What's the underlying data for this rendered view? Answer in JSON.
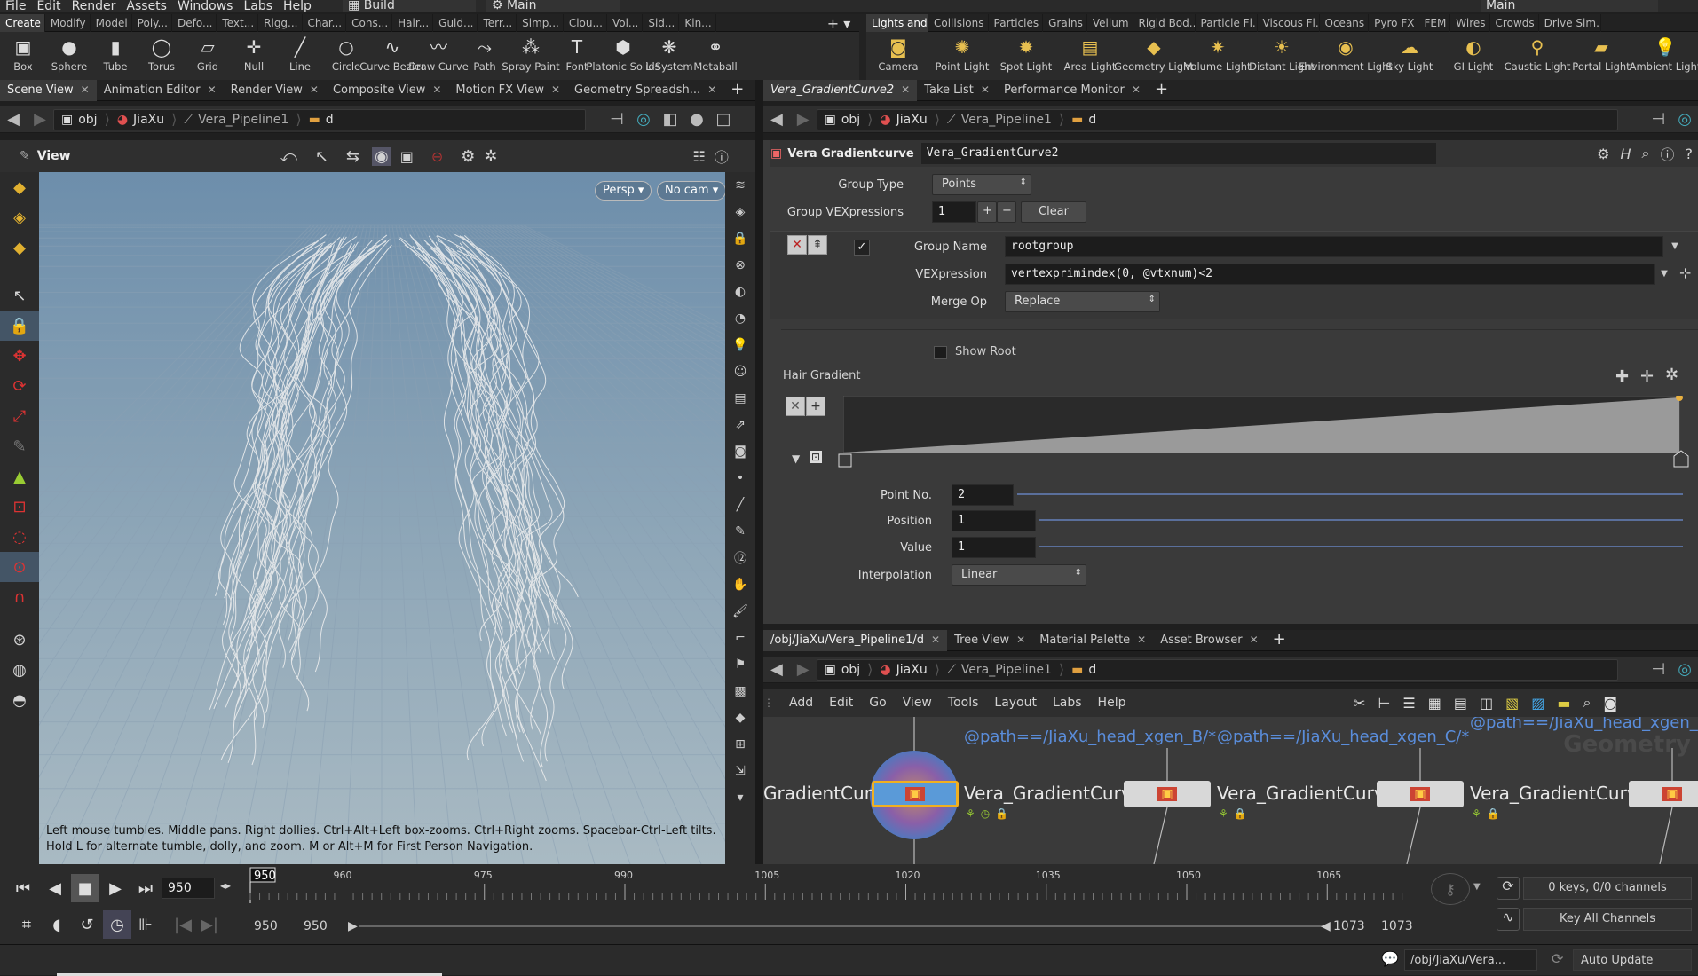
{
  "menubar": {
    "items": [
      "File",
      "Edit",
      "Render",
      "Assets",
      "Windows",
      "Labs",
      "Help"
    ],
    "desktop": "Build",
    "main": "Main",
    "right_main": "Main"
  },
  "shelf_left": {
    "tabs": [
      "Create",
      "Modify",
      "Model",
      "Poly...",
      "Defo...",
      "Text...",
      "Rigg...",
      "Char...",
      "Cons...",
      "Hair...",
      "Guid...",
      "Terr...",
      "Simp...",
      "Clou...",
      "Vol...",
      "Sid...",
      "Kin..."
    ],
    "tools": [
      {
        "label": "Box",
        "icon": "box-icon"
      },
      {
        "label": "Sphere",
        "icon": "sphere-icon"
      },
      {
        "label": "Tube",
        "icon": "tube-icon"
      },
      {
        "label": "Torus",
        "icon": "torus-icon"
      },
      {
        "label": "Grid",
        "icon": "grid-icon"
      },
      {
        "label": "Null",
        "icon": "null-icon"
      },
      {
        "label": "Line",
        "icon": "line-icon"
      },
      {
        "label": "Circle",
        "icon": "circle-icon"
      },
      {
        "label": "Curve Bezier",
        "icon": "curve-bezier-icon"
      },
      {
        "label": "Draw Curve",
        "icon": "draw-curve-icon"
      },
      {
        "label": "Path",
        "icon": "path-icon"
      },
      {
        "label": "Spray Paint",
        "icon": "spray-paint-icon"
      },
      {
        "label": "Font",
        "icon": "font-icon"
      },
      {
        "label": "Platonic Solids",
        "icon": "platonic-icon"
      },
      {
        "label": "L-System",
        "icon": "lsystem-icon"
      },
      {
        "label": "Metaball",
        "icon": "metaball-icon"
      }
    ]
  },
  "shelf_right": {
    "tabs": [
      "Lights and...",
      "Collisions",
      "Particles",
      "Grains",
      "Vellum",
      "Rigid Bod...",
      "Particle Fl...",
      "Viscous Fl...",
      "Oceans",
      "Pyro FX",
      "FEM",
      "Wires",
      "Crowds",
      "Drive Sim..."
    ],
    "tools": [
      {
        "label": "Camera",
        "icon": "camera-icon"
      },
      {
        "label": "Point Light",
        "icon": "point-light-icon"
      },
      {
        "label": "Spot Light",
        "icon": "spot-light-icon"
      },
      {
        "label": "Area Light",
        "icon": "area-light-icon"
      },
      {
        "label": "Geometry Light",
        "icon": "geometry-light-icon"
      },
      {
        "label": "Volume Light",
        "icon": "volume-light-icon"
      },
      {
        "label": "Distant Light",
        "icon": "distant-light-icon"
      },
      {
        "label": "Environment Light",
        "icon": "environment-light-icon"
      },
      {
        "label": "Sky Light",
        "icon": "sky-light-icon"
      },
      {
        "label": "GI Light",
        "icon": "gi-light-icon"
      },
      {
        "label": "Caustic Light",
        "icon": "caustic-light-icon"
      },
      {
        "label": "Portal Light",
        "icon": "portal-light-icon"
      },
      {
        "label": "Ambient Light",
        "icon": "ambient-light-icon"
      }
    ]
  },
  "left_tabs": [
    "Scene View",
    "Animation Editor",
    "Render View",
    "Composite View",
    "Motion FX View",
    "Geometry Spreadsh..."
  ],
  "right_tabs": [
    "Vera_GradientCurve2",
    "Take List",
    "Performance Monitor"
  ],
  "path": {
    "obj": "obj",
    "parent": "JiaXu",
    "pipeline": "Vera_Pipeline1",
    "node": "d"
  },
  "viewport": {
    "title": "View",
    "persp": "Persp",
    "cam": "No cam",
    "hint": "Left mouse tumbles. Middle pans. Right dollies. Ctrl+Alt+Left box-zooms. Ctrl+Right zooms. Spacebar-Ctrl-Left tilts. Hold L for alternate tumble, dolly, and zoom.     M or Alt+M for First Person Navigation."
  },
  "params": {
    "node_type": "Vera Gradientcurve",
    "node_name": "Vera_GradientCurve2",
    "group_type_label": "Group Type",
    "group_type": "Points",
    "group_vex_label": "Group VEXpressions",
    "group_vex_count": "1",
    "clear": "Clear",
    "group_name_label": "Group Name",
    "group_name": "rootgroup",
    "vex_label": "VEXpression",
    "vex": "vertexprimindex(0, @vtxnum)<2",
    "merge_label": "Merge Op",
    "merge": "Replace",
    "show_root": "Show Root",
    "hair_gradient": "Hair Gradient",
    "point_no_label": "Point No.",
    "point_no": "2",
    "position_label": "Position",
    "position": "1",
    "value_label": "Value",
    "value": "1",
    "interp_label": "Interpolation",
    "interp": "Linear"
  },
  "net_tabs": [
    "/obj/JiaXu/Vera_Pipeline1/d",
    "Tree View",
    "Material Palette",
    "Asset Browser"
  ],
  "net_menu": [
    "Add",
    "Edit",
    "Go",
    "View",
    "Tools",
    "Layout",
    "Labs",
    "Help"
  ],
  "network": {
    "watermark": "Geometry",
    "groups": [
      "@path==/JiaXu_head_xgen_B/*",
      "@path==/JiaXu_head_xgen_C/*",
      "@path==/JiaXu_head_xgen_D/*"
    ],
    "nodes": [
      "GradientCurve",
      "Vera_GradientCurve",
      "Vera_GradientCurve",
      "Vera_GradientCurve"
    ]
  },
  "timeline": {
    "current_frame": "950",
    "marker": "950",
    "ticks": [
      "960",
      "975",
      "990",
      "1005",
      "1020",
      "1035",
      "1050",
      "1065"
    ],
    "start": "950",
    "start2": "950",
    "end": "1073",
    "end2": "1073",
    "keys": "0 keys, 0/0 channels",
    "key_all": "Key All Channels"
  },
  "status": {
    "path": "/obj/JiaXu/Vera...",
    "auto_update": "Auto Update"
  }
}
